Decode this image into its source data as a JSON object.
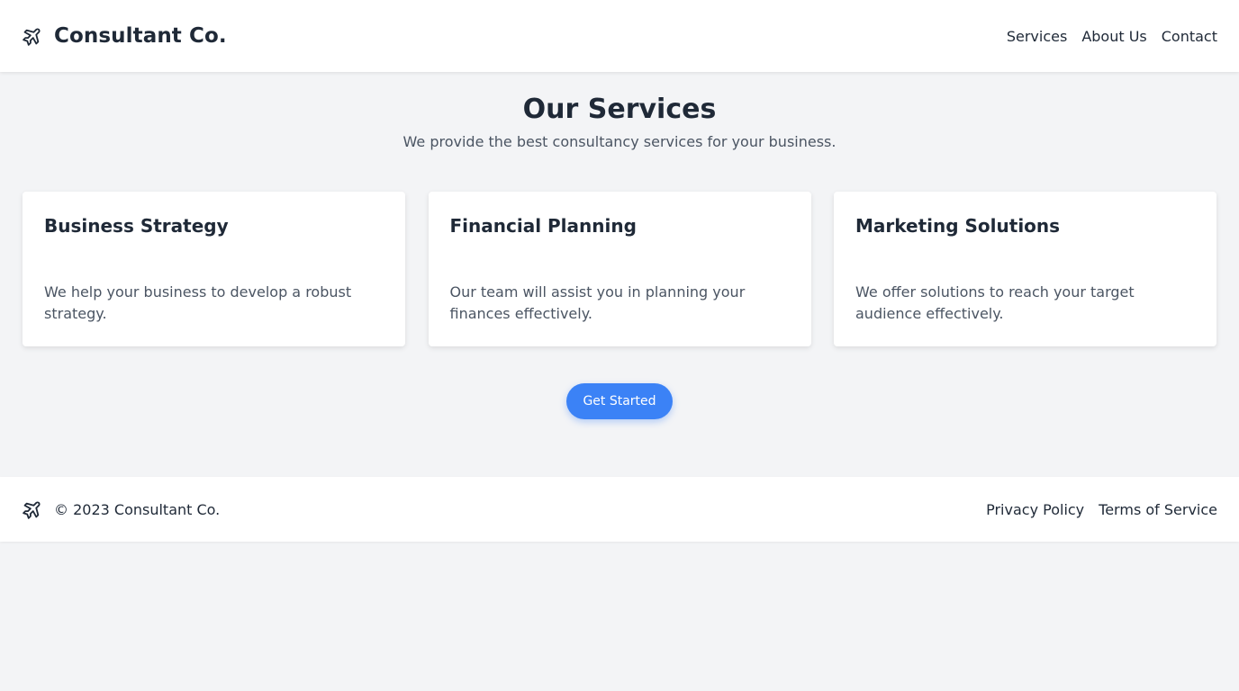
{
  "header": {
    "brand_name": "Consultant Co.",
    "brand_icon": "airplane-icon",
    "nav": [
      "Services",
      "About Us",
      "Contact"
    ]
  },
  "main": {
    "title": "Our Services",
    "subtitle": "We provide the best consultancy services for your business.",
    "cards": [
      {
        "title": "Business Strategy",
        "text": "We help your business to develop a robust strategy."
      },
      {
        "title": "Financial Planning",
        "text": "Our team will assist you in planning your finances effectively."
      },
      {
        "title": "Marketing Solutions",
        "text": "We offer solutions to reach your target audience effectively."
      }
    ],
    "cta_label": "Get Started"
  },
  "footer": {
    "copyright": "© 2023 Consultant Co.",
    "links": [
      "Privacy Policy",
      "Terms of Service"
    ]
  },
  "colors": {
    "background": "#f3f4f6",
    "surface": "#ffffff",
    "text": "#1f2937",
    "muted_text": "#4b5563",
    "accent": "#3b82f6"
  }
}
